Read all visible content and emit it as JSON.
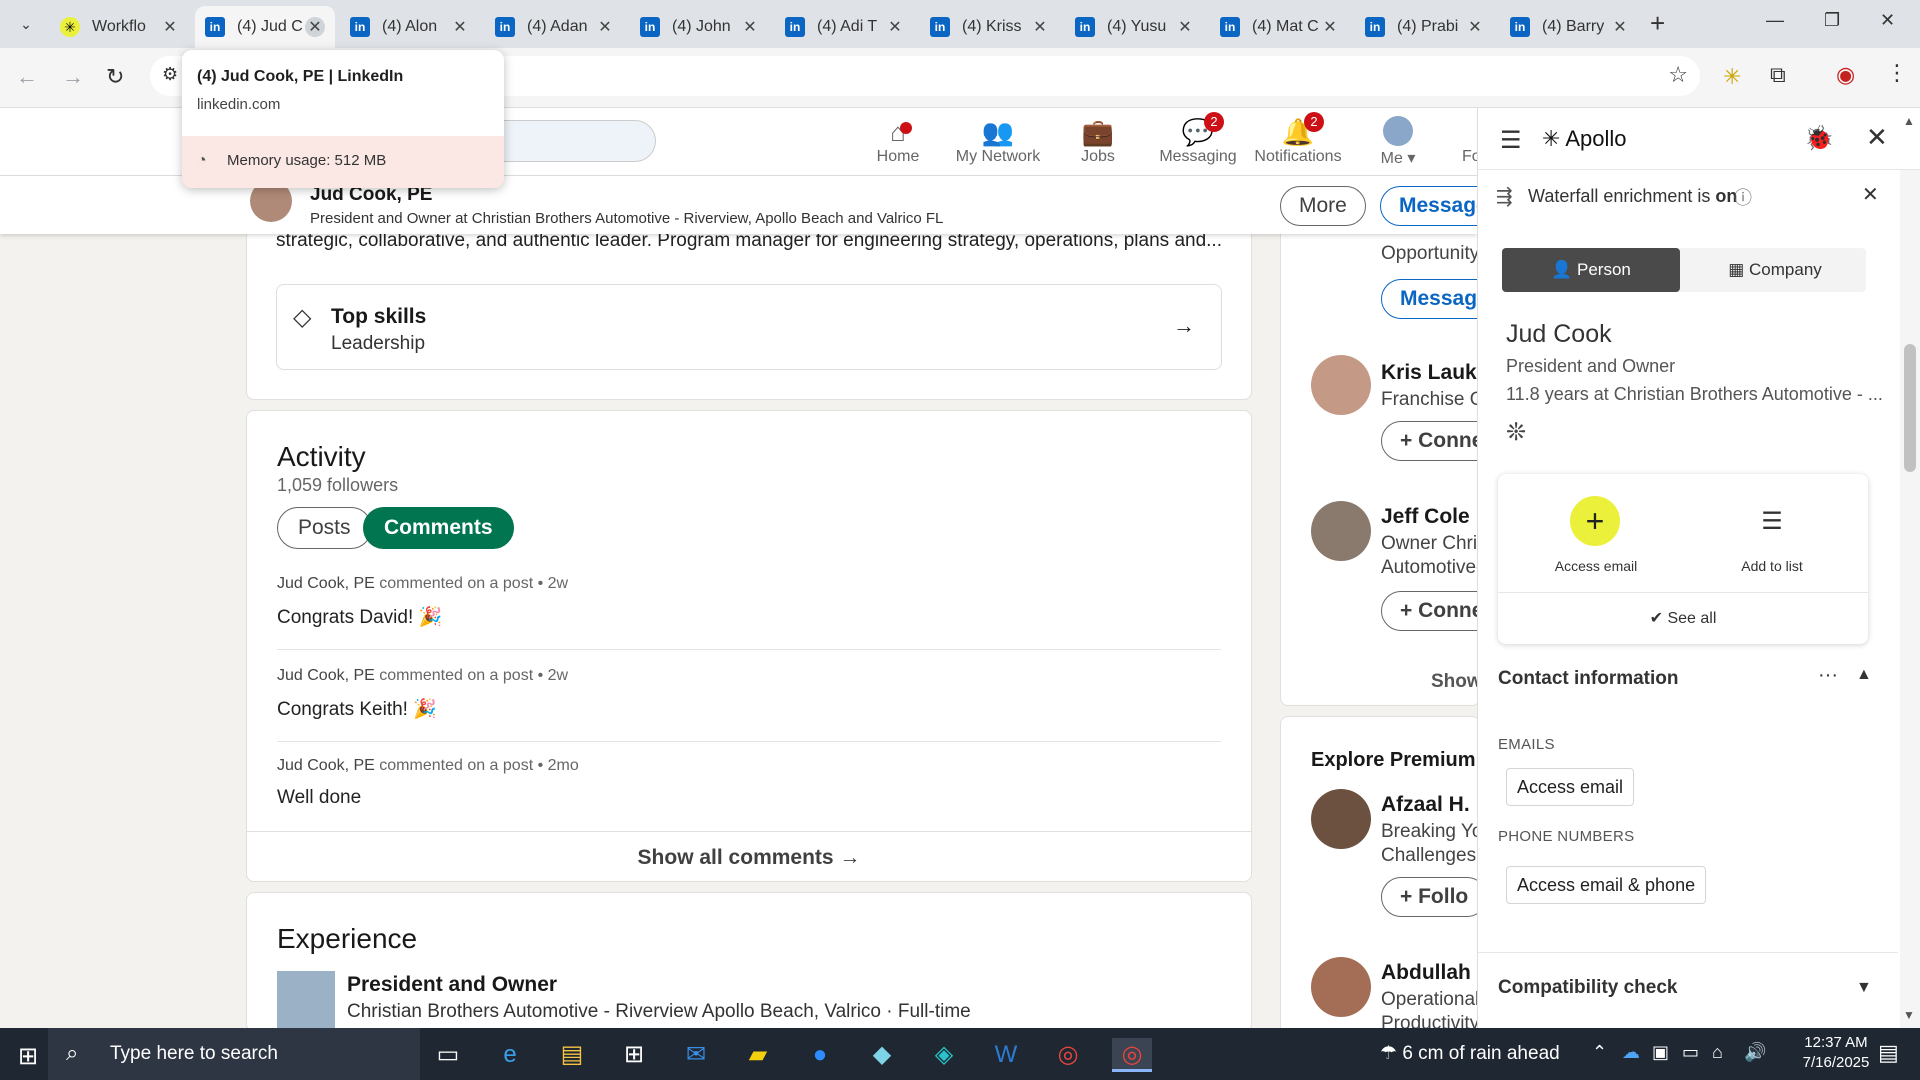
{
  "browser": {
    "tabs": [
      {
        "title": "Workflo",
        "favicon": "apollo-icon"
      },
      {
        "title": "(4) Jud C",
        "favicon": "linkedin-icon",
        "active": true
      },
      {
        "title": "(4) Alon",
        "favicon": "linkedin-icon"
      },
      {
        "title": "(4) Adan",
        "favicon": "linkedin-icon"
      },
      {
        "title": "(4) John",
        "favicon": "linkedin-icon"
      },
      {
        "title": "(4) Adi T",
        "favicon": "linkedin-icon"
      },
      {
        "title": "(4) Kriss",
        "favicon": "linkedin-icon"
      },
      {
        "title": "(4) Yusu",
        "favicon": "linkedin-icon"
      },
      {
        "title": "(4) Mat C",
        "favicon": "linkedin-icon"
      },
      {
        "title": "(4) Prabi",
        "favicon": "linkedin-icon"
      },
      {
        "title": "(4) Barry",
        "favicon": "linkedin-icon"
      }
    ],
    "hover_card": {
      "title": "(4) Jud Cook, PE | LinkedIn",
      "domain": "linkedin.com",
      "memory": "Memory usage: 512 MB"
    }
  },
  "linkedin": {
    "nav": [
      {
        "label": "Home",
        "icon": "home-icon",
        "badge": ""
      },
      {
        "label": "My Network",
        "icon": "network-icon",
        "badge": ""
      },
      {
        "label": "Jobs",
        "icon": "briefcase-icon",
        "badge": ""
      },
      {
        "label": "Messaging",
        "icon": "messaging-icon",
        "badge": "2"
      },
      {
        "label": "Notifications",
        "icon": "bell-icon",
        "badge": "2"
      },
      {
        "label": "Me",
        "icon": "avatar",
        "badge": ""
      }
    ],
    "nav_overflow": "Fo",
    "sticky": {
      "name": "Jud Cook, PE",
      "headline": "President and Owner at Christian Brothers Automotive - Riverview, Apollo Beach and Valrico FL",
      "more_label": "More",
      "message_label": "Message"
    },
    "about_tail": "strategic, collaborative, and authentic leader. Program manager for engineering strategy, operations, plans and...",
    "top_skills": {
      "title": "Top skills",
      "value": "Leadership"
    },
    "activity": {
      "title": "Activity",
      "followers": "1,059 followers",
      "filters": [
        "Posts",
        "Comments"
      ],
      "comments": [
        {
          "author": "Jud Cook, PE",
          "meta": " commented on a post • 2w",
          "text": "Congrats David! 🎉"
        },
        {
          "author": "Jud Cook, PE",
          "meta": " commented on a post • 2w",
          "text": "Congrats Keith! 🎉"
        },
        {
          "author": "Jud Cook, PE",
          "meta": " commented on a post • 2mo",
          "text": "Well done"
        }
      ],
      "show_all": "Show all comments →"
    },
    "experience": {
      "title": "Experience",
      "role": "President and Owner",
      "company": "Christian Brothers Automotive - Riverview Apollo Beach, Valrico · Full-time"
    },
    "rail": {
      "top": {
        "text": "Opportunity",
        "button": "Message"
      },
      "people": [
        {
          "name": "Kris Laukar",
          "sub": "Franchise Op",
          "button": "+ Conne"
        },
        {
          "name": "Jeff Cole",
          "sub1": "Owner Chris",
          "sub2": "Automotive-",
          "button": "+ Conne"
        }
      ],
      "show": "Show",
      "premium_title": "Explore Premium p",
      "premium_people": [
        {
          "name": "Afzaal H.",
          "sub1": "Breaking You",
          "sub2": "Challenges in",
          "button": "+ Follo"
        },
        {
          "name": "Abdullah B",
          "sub1": "Operational",
          "sub2": "Productivity"
        }
      ]
    }
  },
  "apollo": {
    "brand": "Apollo",
    "waterfall": {
      "text_prefix": "Waterfall enrichment is ",
      "state": "on"
    },
    "tabs": [
      "Person",
      "Company"
    ],
    "person": {
      "name": "Jud Cook",
      "title": "President and Owner",
      "tenure": "11.8 years at Christian Brothers Automotive - ..."
    },
    "actions": {
      "access_email": "Access email",
      "add_to_list": "Add to list",
      "see_all": "See all"
    },
    "contact": {
      "title": "Contact information",
      "emails_label": "EMAILS",
      "email_button": "Access email",
      "phones_label": "PHONE NUMBERS",
      "phone_button": "Access email & phone"
    },
    "compat_title": "Compatibility check",
    "accent": "#ebf13a"
  },
  "taskbar": {
    "search_placeholder": "Type here to search",
    "weather": "6 cm of rain ahead",
    "time": "12:37 AM",
    "date": "7/16/2025"
  }
}
